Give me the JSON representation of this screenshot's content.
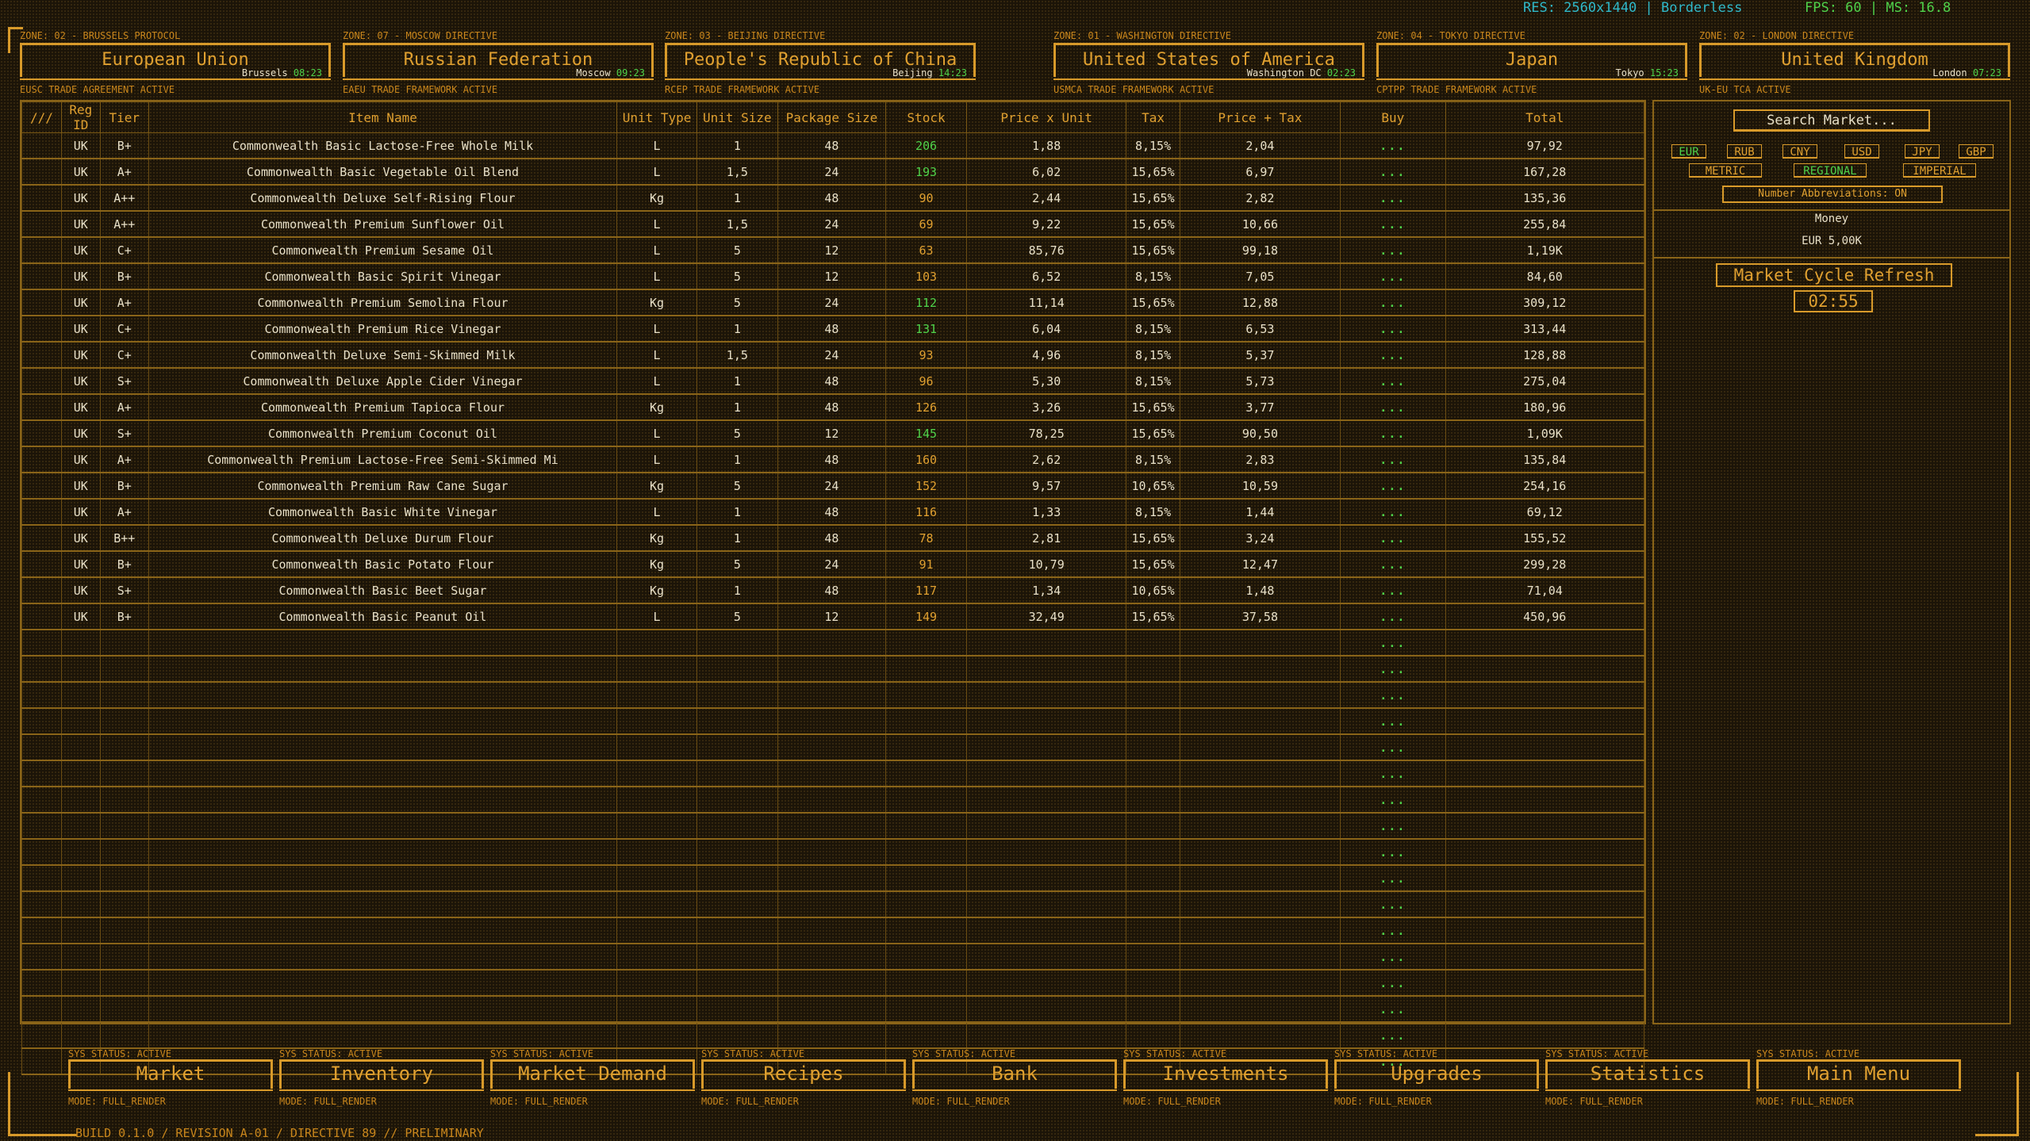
{
  "status": {
    "res": "RES: 2560x1440 | Borderless",
    "fps": "FPS: 60 | MS: 16.8"
  },
  "zones": [
    {
      "label": "ZONE: 02 - BRUSSELS PROTOCOL",
      "name": "European Union",
      "city": "Brussels",
      "time": "08:23",
      "footer": "EUSC TRADE AGREEMENT ACTIVE"
    },
    {
      "label": "ZONE: 07 - MOSCOW DIRECTIVE",
      "name": "Russian Federation",
      "city": "Moscow",
      "time": "09:23",
      "footer": "EAEU TRADE FRAMEWORK ACTIVE"
    },
    {
      "label": "ZONE: 03 - BEIJING DIRECTIVE",
      "name": "People's Republic of China",
      "city": "Beijing",
      "time": "14:23",
      "footer": "RCEP TRADE FRAMEWORK ACTIVE"
    },
    {
      "label": "ZONE: 01 - WASHINGTON DIRECTIVE",
      "name": "United States of America",
      "city": "Washington DC",
      "time": "02:23",
      "footer": "USMCA TRADE FRAMEWORK ACTIVE"
    },
    {
      "label": "ZONE: 04 - TOKYO DIRECTIVE",
      "name": "Japan",
      "city": "Tokyo",
      "time": "15:23",
      "footer": "CPTPP TRADE FRAMEWORK ACTIVE"
    },
    {
      "label": "ZONE: 02 - LONDON DIRECTIVE",
      "name": "United Kingdom",
      "city": "London",
      "time": "07:23",
      "footer": "UK-EU TCA ACTIVE"
    }
  ],
  "table": {
    "headers": [
      "///",
      "Reg ID",
      "Tier",
      "Item Name",
      "Unit Type",
      "Unit Size",
      "Package Size",
      "Stock",
      "Price x Unit",
      "Tax",
      "Price + Tax",
      "Buy",
      "Total"
    ],
    "buy_label": "...",
    "rows": [
      {
        "reg": "UK",
        "tier": "B+",
        "name": "Commonwealth Basic Lactose-Free Whole Milk",
        "utype": "L",
        "usize": "1",
        "pkg": "48",
        "stock": "206",
        "stock_color": "g",
        "price": "1,88",
        "tax": "8,15%",
        "ptax": "2,04",
        "total": "97,92"
      },
      {
        "reg": "UK",
        "tier": "A+",
        "name": "Commonwealth Basic Vegetable Oil Blend",
        "utype": "L",
        "usize": "1,5",
        "pkg": "24",
        "stock": "193",
        "stock_color": "g",
        "price": "6,02",
        "tax": "15,65%",
        "ptax": "6,97",
        "total": "167,28"
      },
      {
        "reg": "UK",
        "tier": "A++",
        "name": "Commonwealth Deluxe Self-Rising Flour",
        "utype": "Kg",
        "usize": "1",
        "pkg": "48",
        "stock": "90",
        "stock_color": "y",
        "price": "2,44",
        "tax": "15,65%",
        "ptax": "2,82",
        "total": "135,36"
      },
      {
        "reg": "UK",
        "tier": "A++",
        "name": "Commonwealth Premium Sunflower Oil",
        "utype": "L",
        "usize": "1,5",
        "pkg": "24",
        "stock": "69",
        "stock_color": "y",
        "price": "9,22",
        "tax": "15,65%",
        "ptax": "10,66",
        "total": "255,84"
      },
      {
        "reg": "UK",
        "tier": "C+",
        "name": "Commonwealth Premium Sesame Oil",
        "utype": "L",
        "usize": "5",
        "pkg": "12",
        "stock": "63",
        "stock_color": "y",
        "price": "85,76",
        "tax": "15,65%",
        "ptax": "99,18",
        "total": "1,19K"
      },
      {
        "reg": "UK",
        "tier": "B+",
        "name": "Commonwealth Basic Spirit Vinegar",
        "utype": "L",
        "usize": "5",
        "pkg": "12",
        "stock": "103",
        "stock_color": "y",
        "price": "6,52",
        "tax": "8,15%",
        "ptax": "7,05",
        "total": "84,60"
      },
      {
        "reg": "UK",
        "tier": "A+",
        "name": "Commonwealth Premium Semolina Flour",
        "utype": "Kg",
        "usize": "5",
        "pkg": "24",
        "stock": "112",
        "stock_color": "g",
        "price": "11,14",
        "tax": "15,65%",
        "ptax": "12,88",
        "total": "309,12"
      },
      {
        "reg": "UK",
        "tier": "C+",
        "name": "Commonwealth Premium Rice Vinegar",
        "utype": "L",
        "usize": "1",
        "pkg": "48",
        "stock": "131",
        "stock_color": "g",
        "price": "6,04",
        "tax": "8,15%",
        "ptax": "6,53",
        "total": "313,44"
      },
      {
        "reg": "UK",
        "tier": "C+",
        "name": "Commonwealth Deluxe Semi-Skimmed Milk",
        "utype": "L",
        "usize": "1,5",
        "pkg": "24",
        "stock": "93",
        "stock_color": "y",
        "price": "4,96",
        "tax": "8,15%",
        "ptax": "5,37",
        "total": "128,88"
      },
      {
        "reg": "UK",
        "tier": "S+",
        "name": "Commonwealth Deluxe Apple Cider Vinegar",
        "utype": "L",
        "usize": "1",
        "pkg": "48",
        "stock": "96",
        "stock_color": "y",
        "price": "5,30",
        "tax": "8,15%",
        "ptax": "5,73",
        "total": "275,04"
      },
      {
        "reg": "UK",
        "tier": "A+",
        "name": "Commonwealth Premium Tapioca Flour",
        "utype": "Kg",
        "usize": "1",
        "pkg": "48",
        "stock": "126",
        "stock_color": "y",
        "price": "3,26",
        "tax": "15,65%",
        "ptax": "3,77",
        "total": "180,96"
      },
      {
        "reg": "UK",
        "tier": "S+",
        "name": "Commonwealth Premium Coconut Oil",
        "utype": "L",
        "usize": "5",
        "pkg": "12",
        "stock": "145",
        "stock_color": "g",
        "price": "78,25",
        "tax": "15,65%",
        "ptax": "90,50",
        "total": "1,09K"
      },
      {
        "reg": "UK",
        "tier": "A+",
        "name": "Commonwealth Premium Lactose-Free Semi-Skimmed Mi",
        "utype": "L",
        "usize": "1",
        "pkg": "48",
        "stock": "160",
        "stock_color": "y",
        "price": "2,62",
        "tax": "8,15%",
        "ptax": "2,83",
        "total": "135,84"
      },
      {
        "reg": "UK",
        "tier": "B+",
        "name": "Commonwealth Premium Raw Cane Sugar",
        "utype": "Kg",
        "usize": "5",
        "pkg": "24",
        "stock": "152",
        "stock_color": "y",
        "price": "9,57",
        "tax": "10,65%",
        "ptax": "10,59",
        "total": "254,16"
      },
      {
        "reg": "UK",
        "tier": "A+",
        "name": "Commonwealth Basic White Vinegar",
        "utype": "L",
        "usize": "1",
        "pkg": "48",
        "stock": "116",
        "stock_color": "y",
        "price": "1,33",
        "tax": "8,15%",
        "ptax": "1,44",
        "total": "69,12"
      },
      {
        "reg": "UK",
        "tier": "B++",
        "name": "Commonwealth Deluxe Durum Flour",
        "utype": "Kg",
        "usize": "1",
        "pkg": "48",
        "stock": "78",
        "stock_color": "y",
        "price": "2,81",
        "tax": "15,65%",
        "ptax": "3,24",
        "total": "155,52"
      },
      {
        "reg": "UK",
        "tier": "B+",
        "name": "Commonwealth Basic Potato Flour",
        "utype": "Kg",
        "usize": "5",
        "pkg": "24",
        "stock": "91",
        "stock_color": "y",
        "price": "10,79",
        "tax": "15,65%",
        "ptax": "12,47",
        "total": "299,28"
      },
      {
        "reg": "UK",
        "tier": "S+",
        "name": "Commonwealth Basic Beet Sugar",
        "utype": "Kg",
        "usize": "1",
        "pkg": "48",
        "stock": "117",
        "stock_color": "y",
        "price": "1,34",
        "tax": "10,65%",
        "ptax": "1,48",
        "total": "71,04"
      },
      {
        "reg": "UK",
        "tier": "B+",
        "name": "Commonwealth Basic Peanut Oil",
        "utype": "L",
        "usize": "5",
        "pkg": "12",
        "stock": "149",
        "stock_color": "y",
        "price": "32,49",
        "tax": "15,65%",
        "ptax": "37,58",
        "total": "450,96"
      }
    ],
    "empty_rows": 17
  },
  "sidebar": {
    "search_placeholder": "Search Market...",
    "currencies": [
      {
        "code": "EUR",
        "active": true
      },
      {
        "code": "RUB",
        "active": false
      },
      {
        "code": "CNY",
        "active": false
      },
      {
        "code": "USD",
        "active": false
      },
      {
        "code": "JPY",
        "active": false
      },
      {
        "code": "GBP",
        "active": false
      }
    ],
    "units": [
      {
        "label": "METRIC",
        "active": false
      },
      {
        "label": "REGIONAL",
        "active": true
      },
      {
        "label": "IMPERIAL",
        "active": false
      }
    ],
    "abbreviations": "Number Abbreviations: ON",
    "money_label": "Money",
    "money_value": "EUR 5,00K",
    "cycle_label": "Market Cycle Refresh",
    "cycle_timer": "02:55"
  },
  "nav": [
    {
      "status": "SYS STATUS: ACTIVE",
      "label": "Market",
      "mode": "MODE: FULL_RENDER"
    },
    {
      "status": "SYS STATUS: ACTIVE",
      "label": "Inventory",
      "mode": "MODE: FULL_RENDER"
    },
    {
      "status": "SYS STATUS: ACTIVE",
      "label": "Market Demand",
      "mode": "MODE: FULL_RENDER"
    },
    {
      "status": "SYS STATUS: ACTIVE",
      "label": "Recipes",
      "mode": "MODE: FULL_RENDER"
    },
    {
      "status": "SYS STATUS: ACTIVE",
      "label": "Bank",
      "mode": "MODE: FULL_RENDER"
    },
    {
      "status": "SYS STATUS: ACTIVE",
      "label": "Investments",
      "mode": "MODE: FULL_RENDER"
    },
    {
      "status": "SYS STATUS: ACTIVE",
      "label": "Upgrades",
      "mode": "MODE: FULL_RENDER"
    },
    {
      "status": "SYS STATUS: ACTIVE",
      "label": "Statistics",
      "mode": "MODE: FULL_RENDER"
    },
    {
      "status": "SYS STATUS: ACTIVE",
      "label": "Main Menu",
      "mode": "MODE: FULL_RENDER"
    }
  ],
  "build": "BUILD 0.1.0 / REVISION A-01 / DIRECTIVE 89 // PRELIMINARY",
  "colors": {
    "accent": "#d89a2a",
    "positive": "#4fd24a",
    "info": "#2fb8c9",
    "background": "#1b1408",
    "text": "#e8e0c8"
  }
}
